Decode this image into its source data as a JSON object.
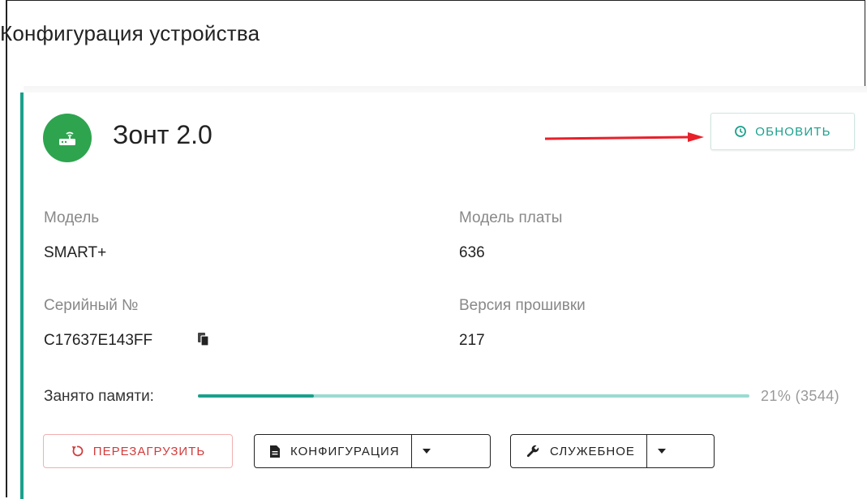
{
  "page": {
    "title": "Конфигурация устройства"
  },
  "device": {
    "name": "Зонт 2.0",
    "avatar_icon": "router-icon",
    "accent_color": "#2ea44f"
  },
  "header": {
    "refresh_label": "ОБНОВИТЬ",
    "refresh_icon": "clock-refresh-icon"
  },
  "info": {
    "model_label": "Модель",
    "model_value": "SMART+",
    "board_label": "Модель платы",
    "board_value": "636",
    "serial_label": "Серийный №",
    "serial_value": "C17637E143FF",
    "firmware_label": "Версия прошивки",
    "firmware_value": "217"
  },
  "memory": {
    "label": "Занято памяти:",
    "value_text": "21% (3544)",
    "fraction": 0.21
  },
  "actions": {
    "reboot_label": "ПЕРЕЗАГРУЗИТЬ",
    "config_label": "КОНФИГУРАЦИЯ",
    "service_label": "СЛУЖЕБНОЕ"
  },
  "colors": {
    "accent": "#1aa08c",
    "danger": "#d23b3b",
    "arrow": "#e8202a"
  }
}
